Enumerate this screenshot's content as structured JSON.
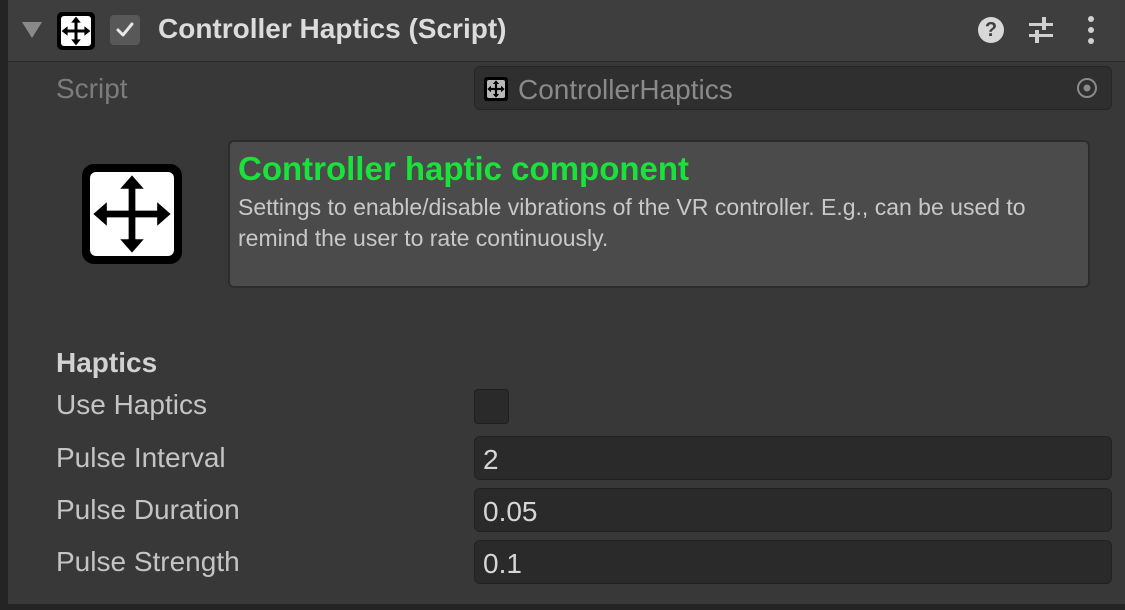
{
  "component": {
    "title": "Controller Haptics (Script)",
    "enabled": true,
    "expanded": true,
    "icons": {
      "foldout": "foldout-down-icon",
      "component": "move-arrows-icon",
      "enabled": "checkmark-icon",
      "help": "help-icon",
      "presets": "presets-sliders-icon",
      "menu": "kebab-menu-icon"
    }
  },
  "script_field": {
    "label": "Script",
    "value": "ControllerHaptics",
    "icon": "move-arrows-icon",
    "picker_icon": "object-picker-icon"
  },
  "info": {
    "title": "Controller haptic component",
    "description": "Settings to enable/disable vibrations of the VR controller. E.g., can be used to remind the user to rate continuously.",
    "icon": "move-arrows-icon",
    "title_color": "#19e23a"
  },
  "haptics": {
    "section_title": "Haptics",
    "use_haptics": {
      "label": "Use Haptics",
      "checked": false
    },
    "pulse_interval": {
      "label": "Pulse Interval",
      "value": "2"
    },
    "pulse_duration": {
      "label": "Pulse Duration",
      "value": "0.05"
    },
    "pulse_strength": {
      "label": "Pulse Strength",
      "value": "0.1"
    }
  }
}
